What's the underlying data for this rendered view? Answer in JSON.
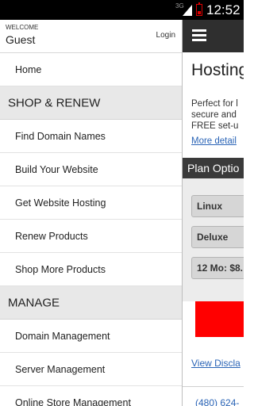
{
  "status_bar": {
    "signal_type": "3G",
    "clock": "12:52",
    "battery_color": "#dd0000"
  },
  "drawer": {
    "welcome_label": "WELCOME",
    "user_name": "Guest",
    "login_label": "Login",
    "home_label": "Home",
    "shop_section": {
      "title": "SHOP & RENEW",
      "items": [
        {
          "label": "Find Domain Names"
        },
        {
          "label": "Build Your Website"
        },
        {
          "label": "Get Website Hosting"
        },
        {
          "label": "Renew Products"
        },
        {
          "label": "Shop More Products"
        }
      ]
    },
    "manage_section": {
      "title": "MANAGE",
      "items": [
        {
          "label": "Domain Management"
        },
        {
          "label": "Server Management"
        },
        {
          "label": "Online Store Management"
        }
      ]
    }
  },
  "content": {
    "menu_icon": "hamburger-menu-icon",
    "title": "Hosting",
    "description_lines": [
      "Perfect for l",
      "secure and",
      "FREE set-u"
    ],
    "more_details_link": "More detail",
    "plan_options_header": "Plan Optio",
    "options": [
      "Linux",
      "Deluxe",
      "12 Mo: $8."
    ],
    "cta_color": "#ff0000",
    "disclaimer_link": "View Discla",
    "phone": "(480) 624-"
  }
}
